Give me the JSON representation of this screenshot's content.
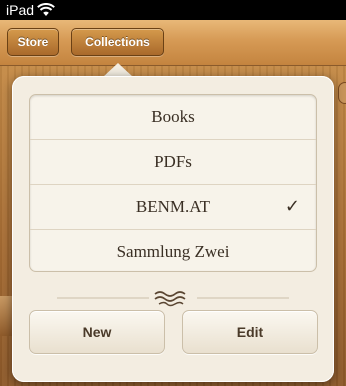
{
  "status_bar": {
    "device": "iPad",
    "wifi_icon": "wifi-icon"
  },
  "toolbar": {
    "store_label": "Store",
    "collections_label": "Collections"
  },
  "popover": {
    "collections": [
      {
        "label": "Books",
        "selected": false
      },
      {
        "label": "PDFs",
        "selected": false
      },
      {
        "label": "BENM.AT",
        "selected": true
      },
      {
        "label": "Sammlung Zwei",
        "selected": false
      }
    ],
    "checkmark": "✓",
    "new_label": "New",
    "edit_label": "Edit"
  }
}
